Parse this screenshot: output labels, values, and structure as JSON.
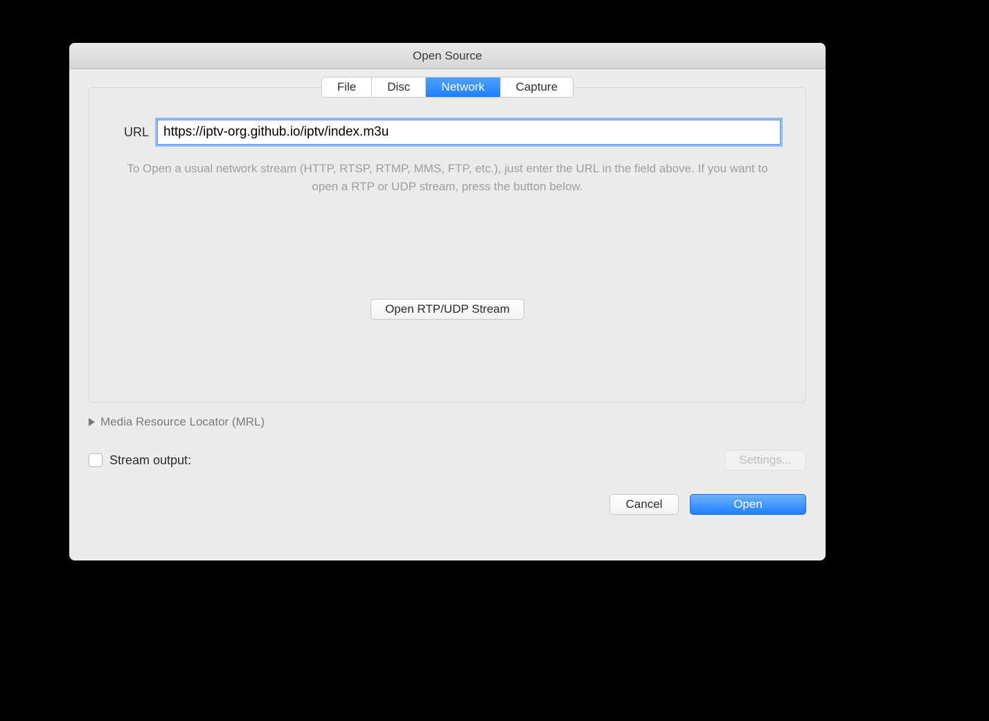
{
  "window": {
    "title": "Open Source"
  },
  "tabs": {
    "file": "File",
    "disc": "Disc",
    "network": "Network",
    "capture": "Capture",
    "active": "network"
  },
  "url": {
    "label": "URL",
    "value": "https://iptv-org.github.io/iptv/index.m3u"
  },
  "hint": "To Open a usual network stream (HTTP, RTSP, RTMP, MMS, FTP, etc.), just enter the URL in the field above. If you want to open a RTP or UDP stream, press the button below.",
  "rtp_button": "Open RTP/UDP Stream",
  "disclosure": {
    "label": "Media Resource Locator (MRL)"
  },
  "stream_output": {
    "label": "Stream output:",
    "checked": false,
    "settings_label": "Settings..."
  },
  "footer": {
    "cancel": "Cancel",
    "open": "Open"
  }
}
